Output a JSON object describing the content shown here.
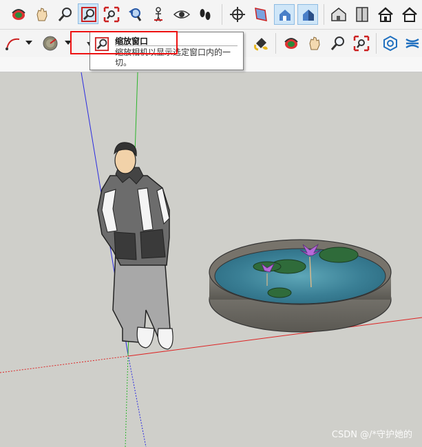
{
  "tooltip": {
    "title": "缩放窗口",
    "line1": "缩放相机以显示选定窗口内的一",
    "line2": "切。"
  },
  "watermark": "CSDN @/*守护她的",
  "toolbar_row1": [
    {
      "name": "orbit-icon",
      "active": false
    },
    {
      "name": "pan-icon",
      "active": false
    },
    {
      "name": "zoom-icon",
      "active": false
    },
    {
      "name": "zoom-window-icon",
      "active": true
    },
    {
      "name": "zoom-extents-icon",
      "active": false
    },
    {
      "name": "previous-view-icon",
      "active": false
    },
    {
      "name": "position-camera-icon",
      "active": false
    },
    {
      "name": "look-around-icon",
      "active": false
    },
    {
      "name": "walk-icon",
      "active": false
    },
    {
      "name": "section-plane-icon",
      "active": false
    },
    {
      "name": "display-section-planes-icon",
      "active": false
    },
    {
      "name": "display-section-cuts-icon",
      "active": true
    },
    {
      "name": "display-section-fill-icon",
      "active": true
    },
    {
      "name": "iso-view-icon",
      "active": false
    },
    {
      "name": "top-view-icon",
      "active": false
    },
    {
      "name": "front-view-icon",
      "active": false
    }
  ],
  "toolbar_row2": [
    {
      "name": "arc-icon"
    },
    {
      "name": "protractor-icon"
    },
    {
      "name": "paint-bucket-icon"
    },
    {
      "name": "orbit-icon"
    },
    {
      "name": "pan-icon"
    },
    {
      "name": "zoom-icon"
    },
    {
      "name": "zoom-extents-icon"
    },
    {
      "name": "warehouse-icon"
    },
    {
      "name": "extension-icon"
    }
  ],
  "colors": {
    "highlight": "#e11111",
    "active_button": "#cfe6f8",
    "viewport_bg": "#cfcfca",
    "water": "#3a7f95"
  }
}
